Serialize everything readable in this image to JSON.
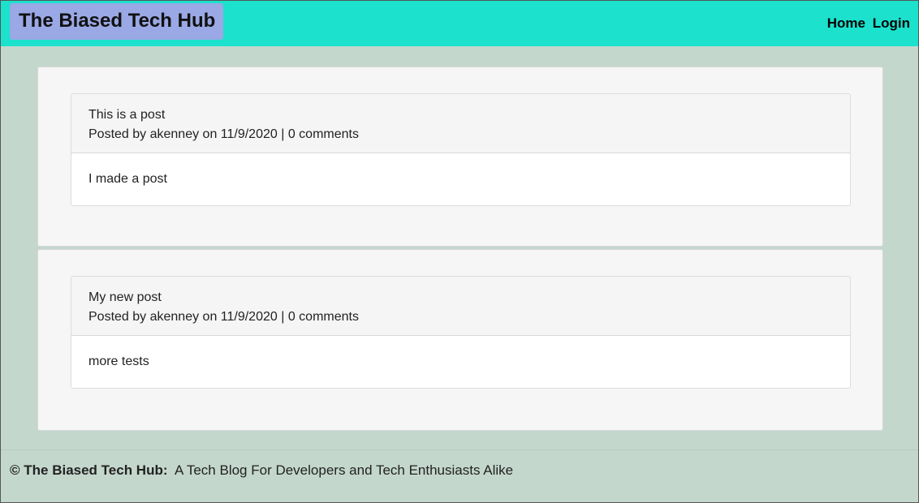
{
  "header": {
    "brand": "The Biased Tech Hub",
    "nav": [
      "Home",
      "Login"
    ]
  },
  "posts": [
    {
      "title": "This is a post",
      "meta": "Posted by akenney on 11/9/2020 | 0 comments",
      "body": "I made a post"
    },
    {
      "title": "My new post",
      "meta": "Posted by akenney on 11/9/2020 | 0 comments",
      "body": "more tests"
    }
  ],
  "footer": {
    "brand": "© The Biased Tech Hub:",
    "tagline": "A Tech Blog For Developers and Tech Enthusiasts Alike"
  },
  "colors": {
    "header_bg": "#1be1cd",
    "brand_bg": "#9aa8e5",
    "page_bg": "#c4d7cd"
  }
}
